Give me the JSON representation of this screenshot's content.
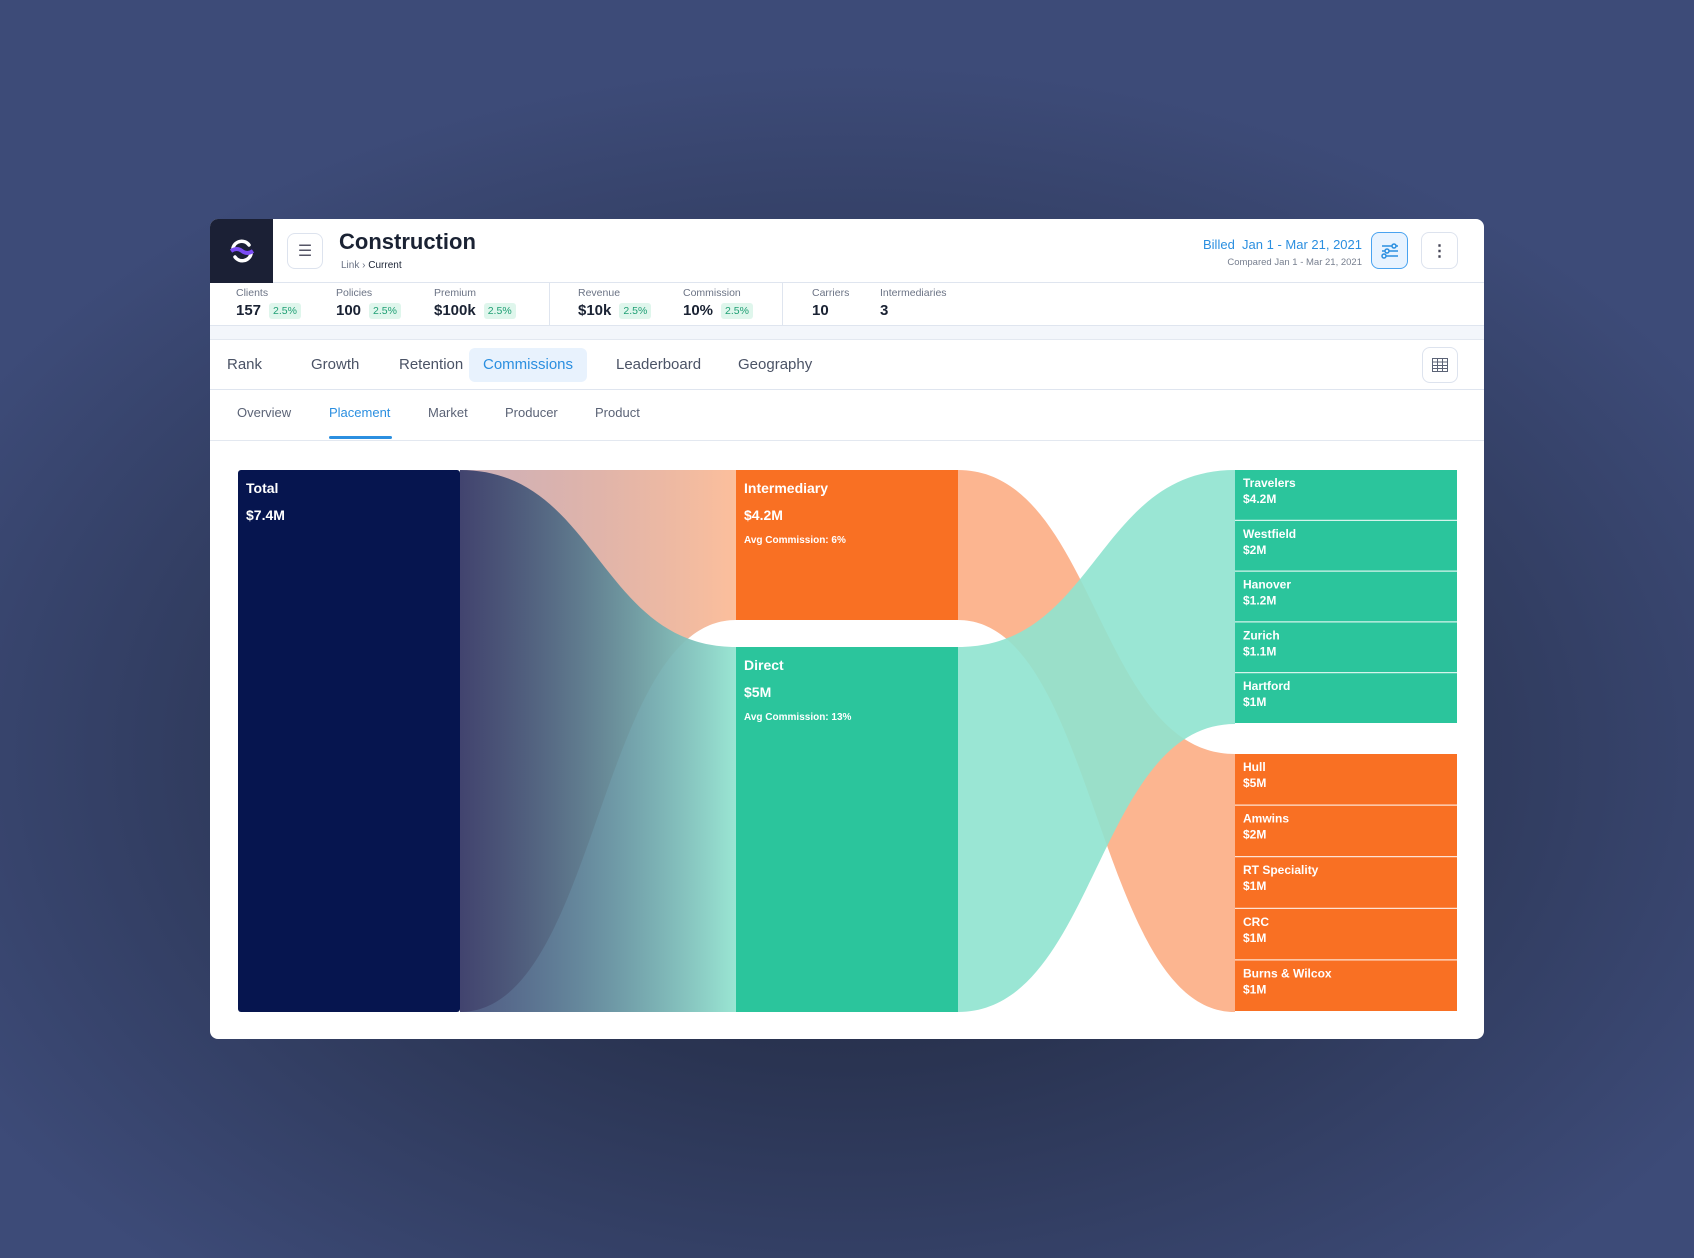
{
  "header": {
    "title": "Construction",
    "breadcrumb": [
      "Link",
      "Current"
    ],
    "billed_label": "Billed",
    "billed_range": "Jan 1 - Mar 21, 2021",
    "compared": "Compared Jan 1 - Mar 21, 2021"
  },
  "stats": [
    {
      "label": "Clients",
      "value": "157",
      "change": "2.5%"
    },
    {
      "label": "Policies",
      "value": "100",
      "change": "2.5%"
    },
    {
      "label": "Premium",
      "value": "$100k",
      "change": "2.5%"
    },
    {
      "label": "Revenue",
      "value": "$10k",
      "change": "2.5%"
    },
    {
      "label": "Commission",
      "value": "10%",
      "change": "2.5%"
    },
    {
      "label": "Carriers",
      "value": "10"
    },
    {
      "label": "Intermediaries",
      "value": "3"
    }
  ],
  "tabs": [
    {
      "label": "Rank"
    },
    {
      "label": "Growth"
    },
    {
      "label": "Retention"
    },
    {
      "label": "Commissions",
      "active": true
    },
    {
      "label": "Leaderboard"
    },
    {
      "label": "Geography"
    }
  ],
  "subtabs": [
    {
      "label": "Overview"
    },
    {
      "label": "Placement",
      "active": true
    },
    {
      "label": "Market"
    },
    {
      "label": "Producer"
    },
    {
      "label": "Product"
    }
  ],
  "colors": {
    "total": "#06154f",
    "intermediary": "#f97023",
    "direct": "#2bc59c",
    "accent": "#2b8fe0"
  },
  "chart_data": {
    "type": "sankey",
    "nodes": {
      "total": {
        "label": "Total",
        "value": "$7.4M"
      },
      "intermediary": {
        "label": "Intermediary",
        "value": "$4.2M",
        "note": "Avg Commission: 6%"
      },
      "direct": {
        "label": "Direct",
        "value": "$5M",
        "note": "Avg Commission: 13%"
      },
      "carriers": [
        {
          "label": "Travelers",
          "value": "$4.2M"
        },
        {
          "label": "Westfield",
          "value": "$2M"
        },
        {
          "label": "Hanover",
          "value": "$1.2M"
        },
        {
          "label": "Zurich",
          "value": "$1.1M"
        },
        {
          "label": "Hartford",
          "value": "$1M"
        }
      ],
      "intermediaries": [
        {
          "label": "Hull",
          "value": "$5M"
        },
        {
          "label": "Amwins",
          "value": "$2M"
        },
        {
          "label": "RT Speciality",
          "value": "$1M"
        },
        {
          "label": "CRC",
          "value": "$1M"
        },
        {
          "label": "Burns & Wilcox",
          "value": "$1M"
        }
      ]
    },
    "links": [
      {
        "source": "Total",
        "target": "Intermediary",
        "value": 4.2
      },
      {
        "source": "Total",
        "target": "Direct",
        "value": 5
      },
      {
        "source": "Direct",
        "target": "Carriers",
        "value": 5
      },
      {
        "source": "Intermediary",
        "target": "Intermediaries",
        "value": 4.2
      }
    ]
  }
}
